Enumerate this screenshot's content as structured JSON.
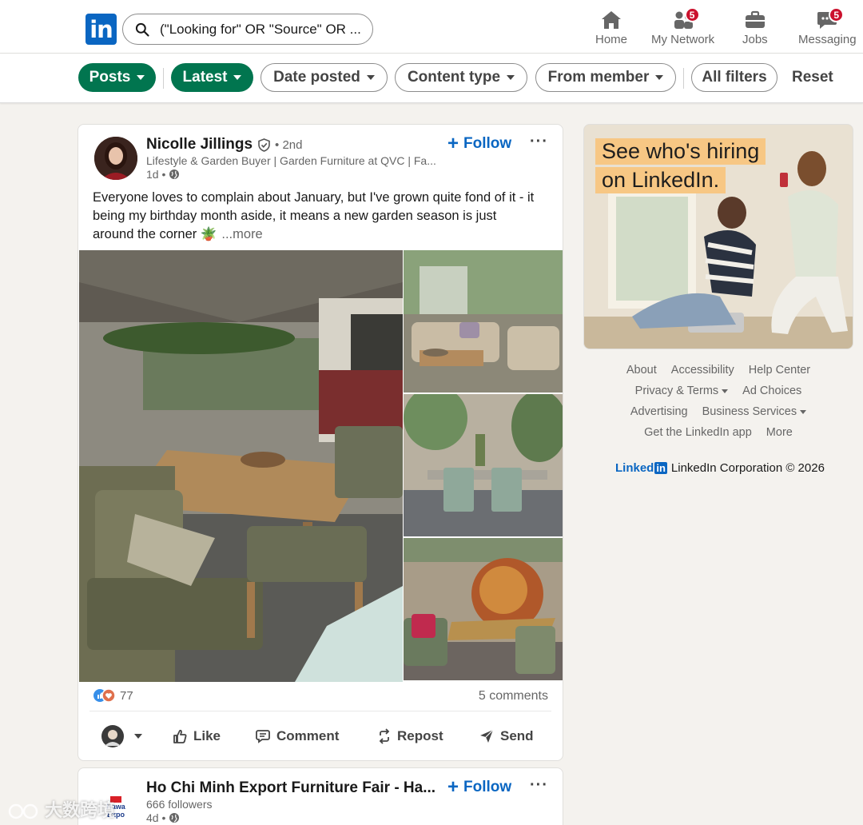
{
  "search": {
    "query": "(\"Looking for\" OR \"Source\" OR ..."
  },
  "nav": {
    "home": "Home",
    "network": "My Network",
    "network_badge": "5",
    "jobs": "Jobs",
    "messaging": "Messaging",
    "messaging_badge": "5"
  },
  "filters": {
    "posts": "Posts",
    "latest": "Latest",
    "date_posted": "Date posted",
    "content_type": "Content type",
    "from_member": "From member",
    "all_filters": "All filters",
    "reset": "Reset"
  },
  "post": {
    "author": "Nicolle Jillings",
    "degree": "• 2nd",
    "headline": "Lifestyle & Garden Buyer | Garden Furniture at QVC | Fa...",
    "time": "1d •",
    "follow": "Follow",
    "more": "···",
    "text": "Everyone loves to complain about January, but I've grown quite fond of it - it being my birthday month aside, it means a new garden season is just around the corner 🪴",
    "see_more": "...more",
    "reaction_count": "77",
    "comments": "5 comments",
    "actions": {
      "like": "Like",
      "comment": "Comment",
      "repost": "Repost",
      "send": "Send"
    }
  },
  "post2": {
    "name": "Ho Chi Minh Export Furniture Fair - Ha...",
    "followers": "666 followers",
    "time": "4d •",
    "follow": "Follow",
    "more": "···",
    "logo_text_1": "Hawa",
    "logo_text_2": "Expo"
  },
  "ad": {
    "line1": "See who's hiring",
    "line2": "on LinkedIn."
  },
  "footer": {
    "about": "About",
    "accessibility": "Accessibility",
    "help": "Help Center",
    "privacy": "Privacy & Terms",
    "ad_choices": "Ad Choices",
    "advertising": "Advertising",
    "business": "Business Services",
    "get_app": "Get the LinkedIn app",
    "more": "More",
    "brand_word": "Linked",
    "brand_in": "in",
    "copyright": "LinkedIn Corporation © 2026"
  },
  "watermark": "大数跨境",
  "colors": {
    "brand": "#0a66c2",
    "active_pill": "#01754f",
    "badge": "#cb112d"
  }
}
